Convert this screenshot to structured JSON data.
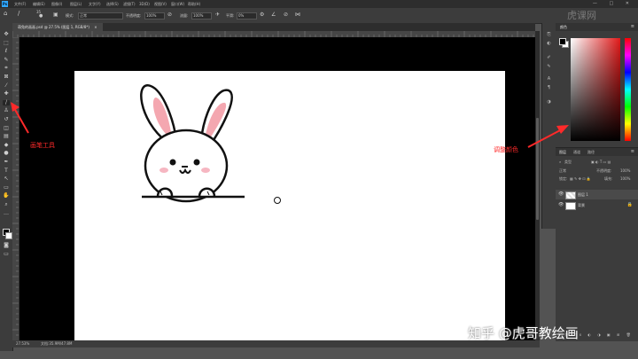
{
  "menubar": {
    "logo": "Ps",
    "items": [
      "文件(F)",
      "编辑(E)",
      "图像(I)",
      "图层(L)",
      "文字(Y)",
      "选择(S)",
      "滤镜(T)",
      "3D(D)",
      "视图(V)",
      "窗口(W)",
      "帮助(H)"
    ],
    "window_controls": "— □ ✕"
  },
  "options_bar": {
    "brush_size": "35",
    "mode_label": "模式:",
    "mode_value": "正常",
    "opacity_label": "不透明度:",
    "opacity_value": "100%",
    "flow_label": "流量:",
    "flow_value": "100%",
    "smooth_label": "平滑:",
    "smooth_value": "0%"
  },
  "document_tab": {
    "label": "萌兔的画画.psd @ 27.5% (图层 1, RGB/8*)",
    "close": "×"
  },
  "status_bar": {
    "zoom": "27.53%",
    "doc_info": "文档:35.9M/47.8M"
  },
  "toolbar": {
    "tools": [
      {
        "name": "move-tool-icon",
        "glyph": "✥"
      },
      {
        "name": "marquee-tool-icon",
        "glyph": "⬚"
      },
      {
        "name": "lasso-tool-icon",
        "glyph": "ℓ"
      },
      {
        "name": "quick-select-tool-icon",
        "glyph": "✎"
      },
      {
        "name": "crop-tool-icon",
        "glyph": "⌗"
      },
      {
        "name": "frame-tool-icon",
        "glyph": "⊠"
      },
      {
        "name": "eyedropper-tool-icon",
        "glyph": "⁄"
      },
      {
        "name": "healing-tool-icon",
        "glyph": "✚"
      },
      {
        "name": "brush-tool-icon",
        "glyph": "/"
      },
      {
        "name": "stamp-tool-icon",
        "glyph": "♙"
      },
      {
        "name": "history-brush-tool-icon",
        "glyph": "↺"
      },
      {
        "name": "eraser-tool-icon",
        "glyph": "◫"
      },
      {
        "name": "gradient-tool-icon",
        "glyph": "▤"
      },
      {
        "name": "blur-tool-icon",
        "glyph": "◆"
      },
      {
        "name": "dodge-tool-icon",
        "glyph": "●"
      },
      {
        "name": "pen-tool-icon",
        "glyph": "✒"
      },
      {
        "name": "type-tool-icon",
        "glyph": "T"
      },
      {
        "name": "path-select-tool-icon",
        "glyph": "↖"
      },
      {
        "name": "shape-tool-icon",
        "glyph": "▭"
      },
      {
        "name": "hand-tool-icon",
        "glyph": "✋"
      },
      {
        "name": "zoom-tool-icon",
        "glyph": "⌕"
      },
      {
        "name": "more-tools-icon",
        "glyph": "…"
      }
    ],
    "active_tool": "brush-tool-icon"
  },
  "color_panel": {
    "tab": "颜色",
    "foreground": "#000000",
    "background": "#ffffff",
    "hue_color": "#e11a1a"
  },
  "layers_panel": {
    "tabs": [
      "图层",
      "通道",
      "路径"
    ],
    "filter_label": "类型",
    "mode_value": "正常",
    "opacity_label": "不透明度:",
    "opacity_value": "100%",
    "lock_label": "锁定:",
    "fill_label": "填充:",
    "fill_value": "100%",
    "layers": [
      {
        "name": "图层 1",
        "selected": true
      },
      {
        "name": "背景",
        "selected": false
      }
    ]
  },
  "annotations": {
    "brush_tool_note": "画笔工具",
    "color_note": "调整颜色",
    "color": "#ff2a2a"
  },
  "watermark": {
    "bottom_right": "知乎 @虎哥教绘画",
    "top_right": "虎课网"
  }
}
